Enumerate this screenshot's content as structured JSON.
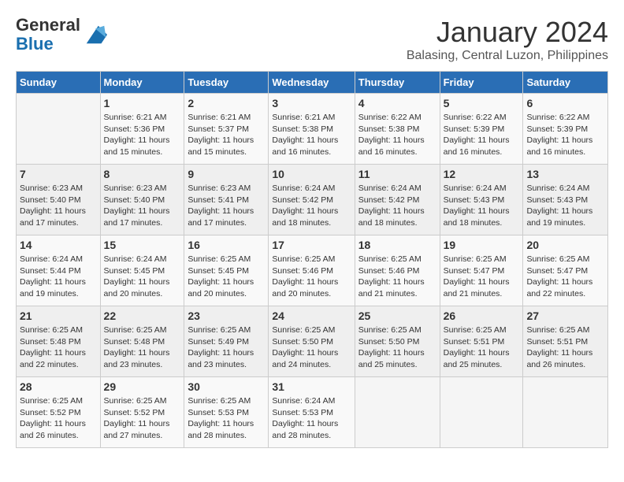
{
  "header": {
    "logo_general": "General",
    "logo_blue": "Blue",
    "month": "January 2024",
    "location": "Balasing, Central Luzon, Philippines"
  },
  "days_of_week": [
    "Sunday",
    "Monday",
    "Tuesday",
    "Wednesday",
    "Thursday",
    "Friday",
    "Saturday"
  ],
  "weeks": [
    [
      {
        "day": "",
        "info": ""
      },
      {
        "day": "1",
        "info": "Sunrise: 6:21 AM\nSunset: 5:36 PM\nDaylight: 11 hours\nand 15 minutes."
      },
      {
        "day": "2",
        "info": "Sunrise: 6:21 AM\nSunset: 5:37 PM\nDaylight: 11 hours\nand 15 minutes."
      },
      {
        "day": "3",
        "info": "Sunrise: 6:21 AM\nSunset: 5:38 PM\nDaylight: 11 hours\nand 16 minutes."
      },
      {
        "day": "4",
        "info": "Sunrise: 6:22 AM\nSunset: 5:38 PM\nDaylight: 11 hours\nand 16 minutes."
      },
      {
        "day": "5",
        "info": "Sunrise: 6:22 AM\nSunset: 5:39 PM\nDaylight: 11 hours\nand 16 minutes."
      },
      {
        "day": "6",
        "info": "Sunrise: 6:22 AM\nSunset: 5:39 PM\nDaylight: 11 hours\nand 16 minutes."
      }
    ],
    [
      {
        "day": "7",
        "info": "Sunrise: 6:23 AM\nSunset: 5:40 PM\nDaylight: 11 hours\nand 17 minutes."
      },
      {
        "day": "8",
        "info": "Sunrise: 6:23 AM\nSunset: 5:40 PM\nDaylight: 11 hours\nand 17 minutes."
      },
      {
        "day": "9",
        "info": "Sunrise: 6:23 AM\nSunset: 5:41 PM\nDaylight: 11 hours\nand 17 minutes."
      },
      {
        "day": "10",
        "info": "Sunrise: 6:24 AM\nSunset: 5:42 PM\nDaylight: 11 hours\nand 18 minutes."
      },
      {
        "day": "11",
        "info": "Sunrise: 6:24 AM\nSunset: 5:42 PM\nDaylight: 11 hours\nand 18 minutes."
      },
      {
        "day": "12",
        "info": "Sunrise: 6:24 AM\nSunset: 5:43 PM\nDaylight: 11 hours\nand 18 minutes."
      },
      {
        "day": "13",
        "info": "Sunrise: 6:24 AM\nSunset: 5:43 PM\nDaylight: 11 hours\nand 19 minutes."
      }
    ],
    [
      {
        "day": "14",
        "info": "Sunrise: 6:24 AM\nSunset: 5:44 PM\nDaylight: 11 hours\nand 19 minutes."
      },
      {
        "day": "15",
        "info": "Sunrise: 6:24 AM\nSunset: 5:45 PM\nDaylight: 11 hours\nand 20 minutes."
      },
      {
        "day": "16",
        "info": "Sunrise: 6:25 AM\nSunset: 5:45 PM\nDaylight: 11 hours\nand 20 minutes."
      },
      {
        "day": "17",
        "info": "Sunrise: 6:25 AM\nSunset: 5:46 PM\nDaylight: 11 hours\nand 20 minutes."
      },
      {
        "day": "18",
        "info": "Sunrise: 6:25 AM\nSunset: 5:46 PM\nDaylight: 11 hours\nand 21 minutes."
      },
      {
        "day": "19",
        "info": "Sunrise: 6:25 AM\nSunset: 5:47 PM\nDaylight: 11 hours\nand 21 minutes."
      },
      {
        "day": "20",
        "info": "Sunrise: 6:25 AM\nSunset: 5:47 PM\nDaylight: 11 hours\nand 22 minutes."
      }
    ],
    [
      {
        "day": "21",
        "info": "Sunrise: 6:25 AM\nSunset: 5:48 PM\nDaylight: 11 hours\nand 22 minutes."
      },
      {
        "day": "22",
        "info": "Sunrise: 6:25 AM\nSunset: 5:48 PM\nDaylight: 11 hours\nand 23 minutes."
      },
      {
        "day": "23",
        "info": "Sunrise: 6:25 AM\nSunset: 5:49 PM\nDaylight: 11 hours\nand 23 minutes."
      },
      {
        "day": "24",
        "info": "Sunrise: 6:25 AM\nSunset: 5:50 PM\nDaylight: 11 hours\nand 24 minutes."
      },
      {
        "day": "25",
        "info": "Sunrise: 6:25 AM\nSunset: 5:50 PM\nDaylight: 11 hours\nand 25 minutes."
      },
      {
        "day": "26",
        "info": "Sunrise: 6:25 AM\nSunset: 5:51 PM\nDaylight: 11 hours\nand 25 minutes."
      },
      {
        "day": "27",
        "info": "Sunrise: 6:25 AM\nSunset: 5:51 PM\nDaylight: 11 hours\nand 26 minutes."
      }
    ],
    [
      {
        "day": "28",
        "info": "Sunrise: 6:25 AM\nSunset: 5:52 PM\nDaylight: 11 hours\nand 26 minutes."
      },
      {
        "day": "29",
        "info": "Sunrise: 6:25 AM\nSunset: 5:52 PM\nDaylight: 11 hours\nand 27 minutes."
      },
      {
        "day": "30",
        "info": "Sunrise: 6:25 AM\nSunset: 5:53 PM\nDaylight: 11 hours\nand 28 minutes."
      },
      {
        "day": "31",
        "info": "Sunrise: 6:24 AM\nSunset: 5:53 PM\nDaylight: 11 hours\nand 28 minutes."
      },
      {
        "day": "",
        "info": ""
      },
      {
        "day": "",
        "info": ""
      },
      {
        "day": "",
        "info": ""
      }
    ]
  ]
}
